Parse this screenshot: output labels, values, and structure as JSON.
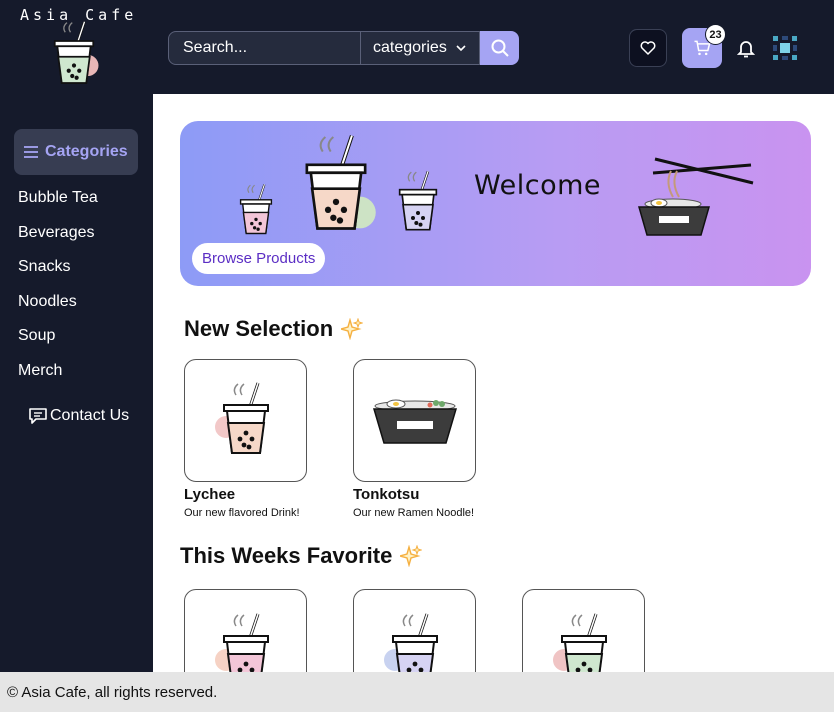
{
  "header": {
    "logo_text": "Asia Cafe",
    "search_placeholder": "Search...",
    "category_select": "categories",
    "cart_count": "23"
  },
  "sidebar": {
    "categories_button": "Categories",
    "items": [
      "Bubble Tea",
      "Beverages",
      "Snacks",
      "Noodles",
      "Soup",
      "Merch"
    ],
    "contact_label": "Contact Us"
  },
  "banner": {
    "welcome": "Welcome",
    "browse_button": "Browse Products"
  },
  "new_selection": {
    "title": "New Selection",
    "products": [
      {
        "name": "Lychee",
        "description": "Our new flavored Drink!",
        "icon": "bubble-tea-peach-icon"
      },
      {
        "name": "Tonkotsu",
        "description": "Our new Ramen Noodle!",
        "icon": "ramen-bowl-icon"
      }
    ]
  },
  "weekly_favorite": {
    "title": "This Weeks Favorite",
    "products": [
      {
        "icon": "bubble-tea-pink-icon"
      },
      {
        "icon": "bubble-tea-lavender-icon"
      },
      {
        "icon": "bubble-tea-green-icon"
      }
    ]
  },
  "footer": {
    "text": "© Asia Cafe, all rights reserved."
  },
  "colors": {
    "nav_bg": "#151a2b",
    "accent": "#a5a4f3",
    "banner_start": "#8d9bf6",
    "banner_end": "#c993f0",
    "sparkle": "#f5b041"
  }
}
